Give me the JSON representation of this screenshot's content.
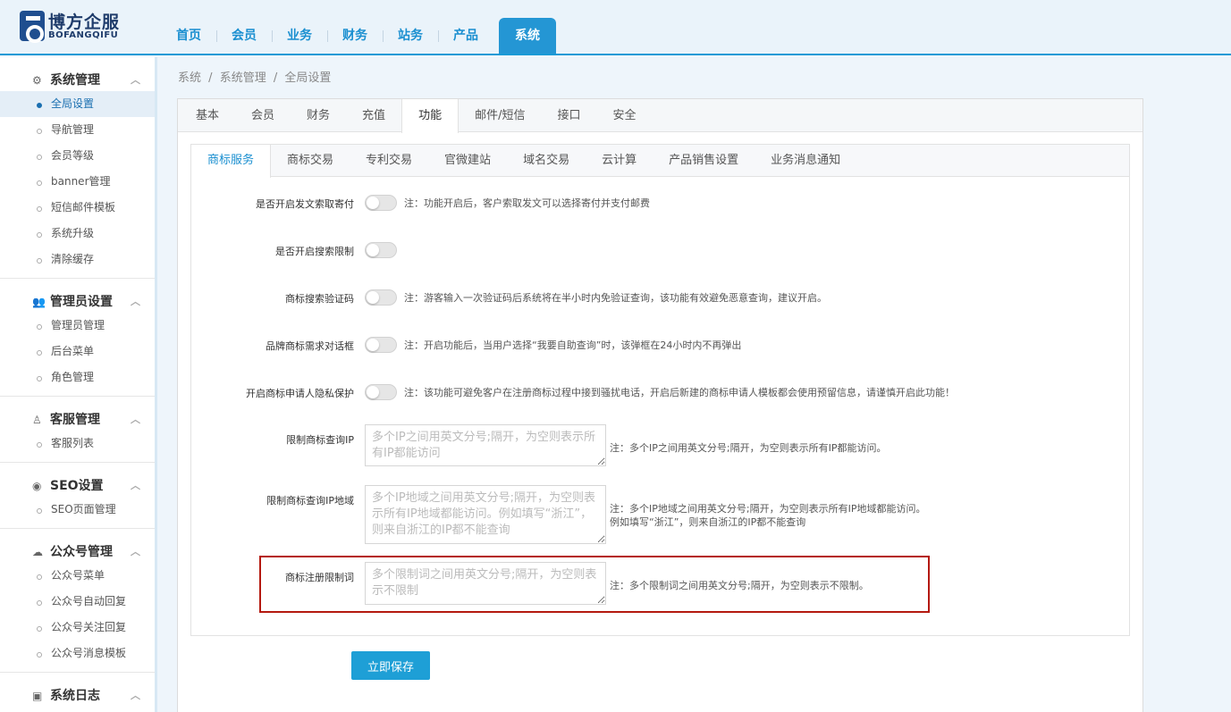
{
  "logo": {
    "cn": "博方企服",
    "en": "BOFANGQIFU"
  },
  "topnav": [
    "首页",
    "会员",
    "业务",
    "财务",
    "站务",
    "产品",
    "系统"
  ],
  "sidebar": {
    "groups": [
      {
        "title": "系统管理",
        "icon": "gears-icon",
        "items": [
          "全局设置",
          "导航管理",
          "会员等级",
          "banner管理",
          "短信邮件模板",
          "系统升级",
          "清除缓存"
        ]
      },
      {
        "title": "管理员设置",
        "icon": "users-icon",
        "items": [
          "管理员管理",
          "后台菜单",
          "角色管理"
        ]
      },
      {
        "title": "客服管理",
        "icon": "support-icon",
        "items": [
          "客服列表"
        ]
      },
      {
        "title": "SEO设置",
        "icon": "globe-icon",
        "items": [
          "SEO页面管理"
        ]
      },
      {
        "title": "公众号管理",
        "icon": "wechat-icon",
        "items": [
          "公众号菜单",
          "公众号自动回复",
          "公众号关注回复",
          "公众号消息模板"
        ]
      },
      {
        "title": "系统日志",
        "icon": "log-icon",
        "items": []
      }
    ]
  },
  "breadcrumb": [
    "系统",
    "/",
    "系统管理",
    "/",
    "全局设置"
  ],
  "tabs1": [
    "基本",
    "会员",
    "财务",
    "充值",
    "功能",
    "邮件/短信",
    "接口",
    "安全"
  ],
  "tabs2": [
    "商标服务",
    "商标交易",
    "专利交易",
    "官微建站",
    "域名交易",
    "云计算",
    "产品销售设置",
    "业务消息通知"
  ],
  "settings": {
    "s1": {
      "label": "是否开启发文索取寄付",
      "note": "注：功能开启后，客户索取发文可以选择寄付并支付邮费"
    },
    "s2": {
      "label": "是否开启搜索限制"
    },
    "s3": {
      "label": "商标搜索验证码",
      "note": "注：游客输入一次验证码后系统将在半小时内免验证查询，该功能有效避免恶意查询，建议开启。"
    },
    "s4": {
      "label": "品牌商标需求对话框",
      "note": "注：开启功能后，当用户选择“我要自助查询”时，该弹框在24小时内不再弹出"
    },
    "s5": {
      "label": "开启商标申请人隐私保护",
      "note": "注：该功能可避免客户在注册商标过程中接到骚扰电话，开启后新建的商标申请人模板都会使用预留信息，请谨慎开启此功能！"
    },
    "t1": {
      "label": "限制商标查询IP",
      "placeholder": "多个IP之间用英文分号;隔开，为空则表示所有IP都能访问",
      "note": "注：多个IP之间用英文分号;隔开，为空则表示所有IP都能访问。"
    },
    "t2": {
      "label": "限制商标查询IP地域",
      "placeholder": "多个IP地域之间用英文分号;隔开，为空则表示所有IP地域都能访问。例如填写“浙江”，则来自浙江的IP都不能查询",
      "note1": "注：多个IP地域之间用英文分号;隔开，为空则表示所有IP地域都能访问。",
      "note2": "例如填写“浙江”，则来自浙江的IP都不能查询"
    },
    "t3": {
      "label": "商标注册限制词",
      "placeholder": "多个限制词之间用英文分号;隔开，为空则表示不限制",
      "note": "注：多个限制词之间用英文分号;隔开，为空则表示不限制。"
    }
  },
  "save_label": "立即保存"
}
